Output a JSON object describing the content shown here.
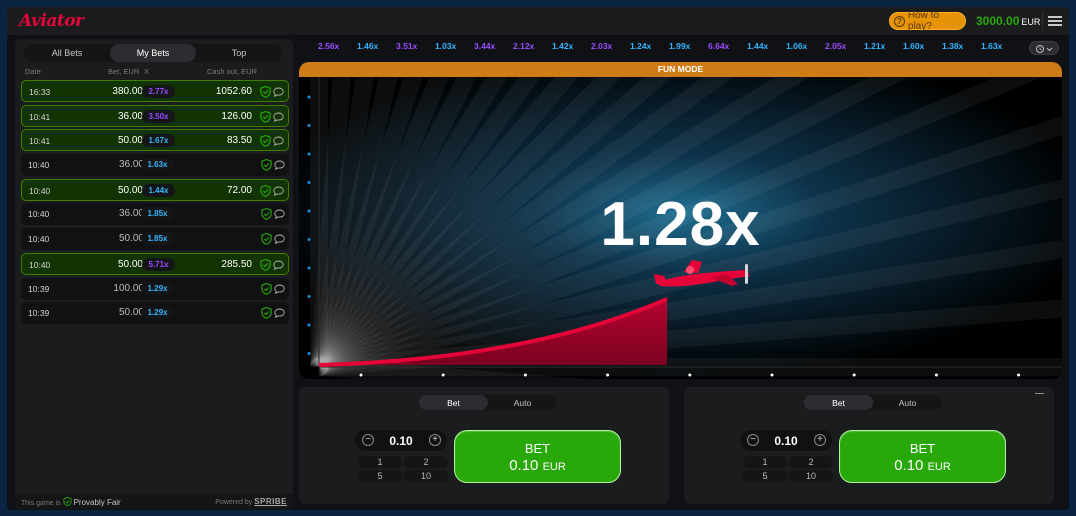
{
  "header": {
    "logo": "Aviator",
    "how_to_play": "How to play?",
    "balance": "3000.00",
    "currency": "EUR"
  },
  "bets_panel": {
    "tabs": [
      "All Bets",
      "My Bets",
      "Top"
    ],
    "active_tab": "My Bets",
    "columns": {
      "date": "Date",
      "bet": "Bet, EUR",
      "x": "X",
      "cashout": "Cash out, EUR"
    },
    "rows": [
      {
        "time": "16:33",
        "bet": "380.00",
        "mult": "2.77x",
        "mult_color": "#9a4bff",
        "cashout": "1052.60",
        "win": true
      },
      {
        "time": "10:41",
        "bet": "36.00",
        "mult": "3.50x",
        "mult_color": "#9a4bff",
        "cashout": "126.00",
        "win": true
      },
      {
        "time": "10:41",
        "bet": "50.00",
        "mult": "1.67x",
        "mult_color": "#34b4ff",
        "cashout": "83.50",
        "win": true
      },
      {
        "time": "10:40",
        "bet": "36.00",
        "mult": "1.63x",
        "mult_color": "#34b4ff",
        "cashout": "",
        "win": false
      },
      {
        "time": "10:40",
        "bet": "50.00",
        "mult": "1.44x",
        "mult_color": "#34b4ff",
        "cashout": "72.00",
        "win": true
      },
      {
        "time": "10:40",
        "bet": "36.00",
        "mult": "1.85x",
        "mult_color": "#34b4ff",
        "cashout": "",
        "win": false
      },
      {
        "time": "10:40",
        "bet": "50.00",
        "mult": "1.85x",
        "mult_color": "#34b4ff",
        "cashout": "",
        "win": false
      },
      {
        "time": "10:40",
        "bet": "50.00",
        "mult": "5.71x",
        "mult_color": "#9a4bff",
        "cashout": "285.50",
        "win": true
      },
      {
        "time": "10:39",
        "bet": "100.00",
        "mult": "1.29x",
        "mult_color": "#34b4ff",
        "cashout": "",
        "win": false
      },
      {
        "time": "10:39",
        "bet": "50.00",
        "mult": "1.29x",
        "mult_color": "#34b4ff",
        "cashout": "",
        "win": false
      }
    ],
    "footer": {
      "fair_prefix": "This game is",
      "fair_label": "Provably Fair",
      "powered_prefix": "Powered by",
      "powered_brand": "SPRIBE"
    }
  },
  "history": [
    {
      "value": "2.56x",
      "color": "#9a4bff"
    },
    {
      "value": "1.46x",
      "color": "#34b4ff"
    },
    {
      "value": "3.51x",
      "color": "#9a4bff"
    },
    {
      "value": "1.03x",
      "color": "#34b4ff"
    },
    {
      "value": "3.44x",
      "color": "#9a4bff"
    },
    {
      "value": "2.12x",
      "color": "#9a4bff"
    },
    {
      "value": "1.42x",
      "color": "#34b4ff"
    },
    {
      "value": "2.03x",
      "color": "#9a4bff"
    },
    {
      "value": "1.24x",
      "color": "#34b4ff"
    },
    {
      "value": "1.99x",
      "color": "#34b4ff"
    },
    {
      "value": "6.64x",
      "color": "#9a4bff"
    },
    {
      "value": "1.44x",
      "color": "#34b4ff"
    },
    {
      "value": "1.06x",
      "color": "#34b4ff"
    },
    {
      "value": "2.05x",
      "color": "#9a4bff"
    },
    {
      "value": "1.21x",
      "color": "#34b4ff"
    },
    {
      "value": "1.60x",
      "color": "#34b4ff"
    },
    {
      "value": "1.38x",
      "color": "#34b4ff"
    },
    {
      "value": "1.63x",
      "color": "#34b4ff"
    }
  ],
  "game": {
    "mode_label": "FUN MODE",
    "multiplier": "1.28x",
    "plane_color": "#e50539"
  },
  "bet_panels": [
    {
      "tabs": [
        "Bet",
        "Auto"
      ],
      "active_tab": "Bet",
      "stake": "0.10",
      "quick": [
        "1",
        "2",
        "5",
        "10"
      ],
      "button_label": "BET",
      "button_amount": "0.10",
      "button_currency": "EUR"
    },
    {
      "tabs": [
        "Bet",
        "Auto"
      ],
      "active_tab": "Bet",
      "stake": "0.10",
      "quick": [
        "1",
        "2",
        "5",
        "10"
      ],
      "button_label": "BET",
      "button_amount": "0.10",
      "button_currency": "EUR"
    }
  ]
}
